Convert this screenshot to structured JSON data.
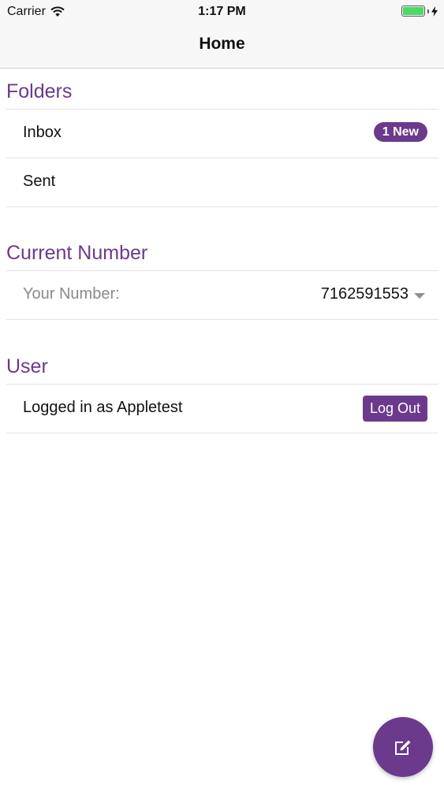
{
  "status_bar": {
    "carrier": "Carrier",
    "time": "1:17 PM",
    "icons": [
      "wifi-icon",
      "battery-icon",
      "charging-bolt-icon"
    ],
    "battery_color": "#4cd964"
  },
  "nav": {
    "title": "Home"
  },
  "folders": {
    "header": "Folders",
    "items": [
      {
        "label": "Inbox",
        "badge": "1 New"
      },
      {
        "label": "Sent"
      }
    ]
  },
  "current_number": {
    "header": "Current Number",
    "label": "Your Number:",
    "value": "7162591553",
    "icon": "chevron-down-icon"
  },
  "user": {
    "header": "User",
    "logged_in_text": "Logged in as Appletest",
    "logout_label": "Log Out"
  },
  "fab": {
    "icon": "compose-icon"
  },
  "colors": {
    "accent": "#6b3a8c",
    "nav_background": "#f7f7f7",
    "separator": "#e3e3e6"
  }
}
